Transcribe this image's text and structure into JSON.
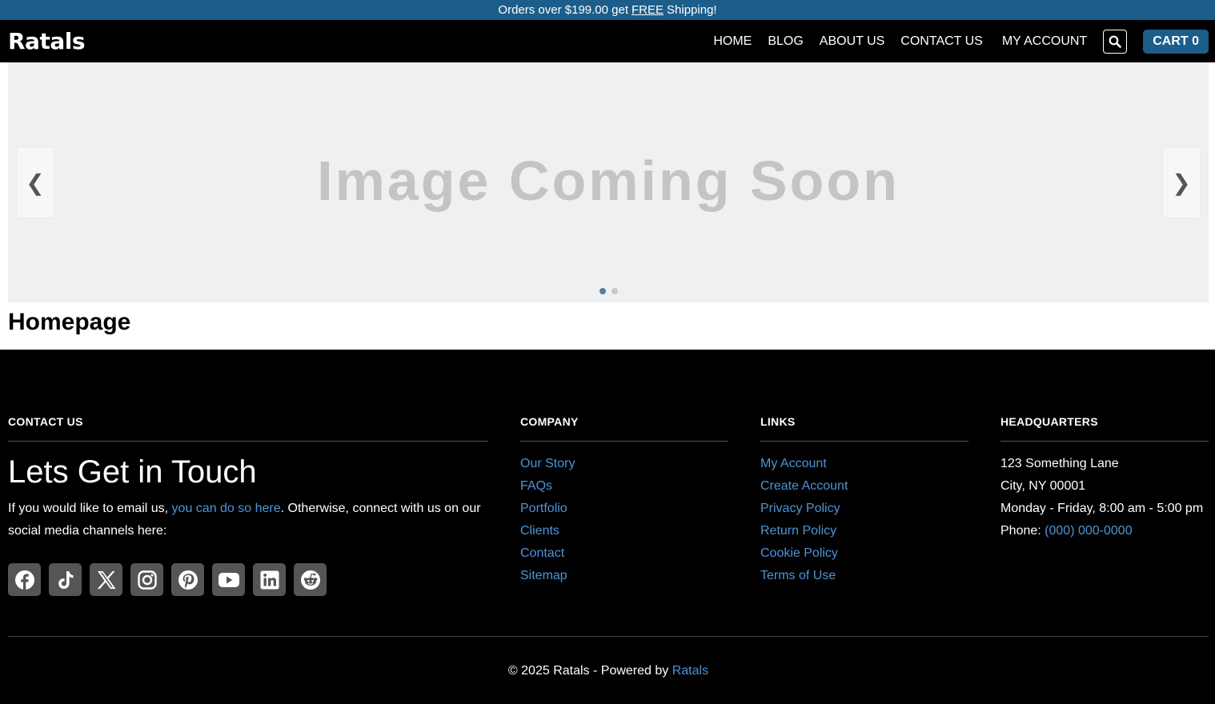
{
  "announcement": {
    "prefix": "Orders over $199.00 get",
    "free": "FREE",
    "suffix": "Shipping!"
  },
  "header": {
    "logo": "Ratals",
    "nav": [
      "HOME",
      "BLOG",
      "ABOUT US",
      "CONTACT US",
      "MY ACCOUNT"
    ],
    "cart_label": "CART 0",
    "search_icon": "search-icon"
  },
  "slider": {
    "slide_text": "Image Coming Soon",
    "prev": "❮",
    "next": "❯",
    "slide_count": 2,
    "active_slide": 1
  },
  "page_title": "Homepage",
  "footer": {
    "contact": {
      "heading": "CONTACT US",
      "title": "Lets Get in Touch",
      "text_before": "If you would like to email us,",
      "link": "you can do so here",
      "text_after": ". Otherwise, connect with us on our social media channels here:",
      "socials": [
        "facebook-icon",
        "tiktok-icon",
        "x-icon",
        "instagram-icon",
        "pinterest-icon",
        "youtube-icon",
        "linkedin-icon",
        "reddit-icon"
      ]
    },
    "company": {
      "heading": "COMPANY",
      "links": [
        "Our Story",
        "FAQs",
        "Portfolio",
        "Clients",
        "Contact",
        "Sitemap"
      ]
    },
    "links": {
      "heading": "LINKS",
      "links": [
        "My Account",
        "Create Account",
        "Privacy Policy",
        "Return Policy",
        "Cookie Policy",
        "Terms of Use"
      ]
    },
    "hq": {
      "heading": "HEADQUARTERS",
      "address1": "123 Something Lane",
      "address2": "City, NY 00001",
      "hours": "Monday - Friday, 8:00 am - 5:00 pm",
      "phone_label": "Phone:",
      "phone": "(000) 000-0000"
    },
    "copyright_prefix": "© 2025 Ratals - Powered by",
    "copyright_link": "Ratals"
  },
  "colors": {
    "brand": "#1c5d8a",
    "link": "#4d94d6",
    "footer_bg": "#000000"
  }
}
